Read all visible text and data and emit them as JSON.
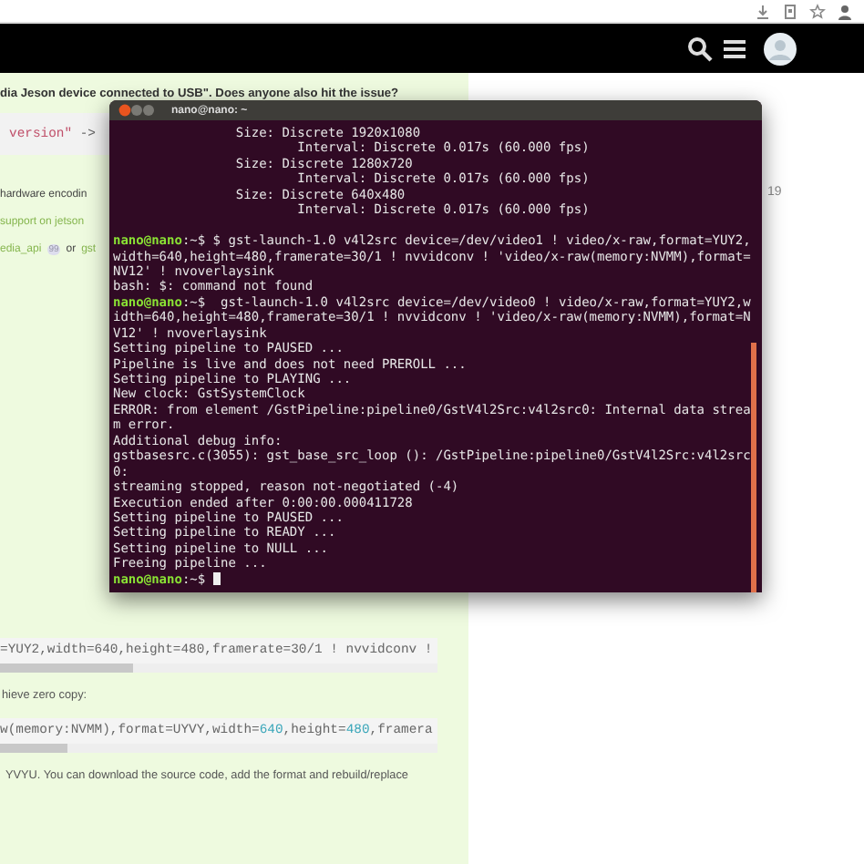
{
  "post": {
    "title": "dia Jeson device connected to USB\". Does anyone also hit the issue?",
    "code_top": [
      {
        "text": "version\"",
        "kind": "string"
      },
      {
        "text": " ->",
        "kind": "plain"
      }
    ],
    "lines": [
      [
        {
          "text": "hardware encodin",
          "kind": "text"
        }
      ],
      [
        {
          "text": "support on jetson",
          "kind": "link"
        }
      ],
      [
        {
          "text": "edia_api",
          "kind": "link"
        },
        {
          "text": "99",
          "kind": "badge"
        },
        {
          "text": "or",
          "kind": "text"
        },
        {
          "text": "gst",
          "kind": "link"
        }
      ]
    ],
    "code_block_1": [
      {
        "text": "=YUY2,width=640,height=480,framerate=30/1 ! nvvidconv !",
        "kind": "plain"
      }
    ],
    "text_2": "hieve zero copy:",
    "code_block_2": [
      {
        "text": "w(memory:NVMM),format=UYVY,width=",
        "kind": "plain"
      },
      {
        "text": "640",
        "kind": "number"
      },
      {
        "text": ",height=",
        "kind": "plain"
      },
      {
        "text": "480",
        "kind": "number"
      },
      {
        "text": ",framera",
        "kind": "plain"
      }
    ],
    "text_3": "YVYU. You can download the source code, add the format and rebuild/replace"
  },
  "side": {
    "date": "19"
  },
  "terminal": {
    "title": "nano@nano: ~",
    "lines": [
      {
        "kind": "output",
        "text": "                Size: Discrete 1920x1080"
      },
      {
        "kind": "output",
        "text": "                        Interval: Discrete 0.017s (60.000 fps)"
      },
      {
        "kind": "output",
        "text": "                Size: Discrete 1280x720"
      },
      {
        "kind": "output",
        "text": "                        Interval: Discrete 0.017s (60.000 fps)"
      },
      {
        "kind": "output",
        "text": "                Size: Discrete 640x480"
      },
      {
        "kind": "output",
        "text": "                        Interval: Discrete 0.017s (60.000 fps)"
      },
      {
        "kind": "blank"
      },
      {
        "kind": "prompt",
        "prompt": "nano@nano",
        "text": ":~$ $ gst-launch-1.0 v4l2src device=/dev/video1 ! video/x-raw,format=YUY2,"
      },
      {
        "kind": "output",
        "text": "width=640,height=480,framerate=30/1 ! nvvidconv ! 'video/x-raw(memory:NVMM),format="
      },
      {
        "kind": "output",
        "text": "NV12' ! nvoverlaysink"
      },
      {
        "kind": "output",
        "text": "bash: $: command not found"
      },
      {
        "kind": "prompt",
        "prompt": "nano@nano",
        "text": ":~$  gst-launch-1.0 v4l2src device=/dev/video0 ! video/x-raw,format=YUY2,w"
      },
      {
        "kind": "output",
        "text": "idth=640,height=480,framerate=30/1 ! nvvidconv ! 'video/x-raw(memory:NVMM),format=N"
      },
      {
        "kind": "output",
        "text": "V12' ! nvoverlaysink"
      },
      {
        "kind": "output",
        "text": "Setting pipeline to PAUSED ..."
      },
      {
        "kind": "output",
        "text": "Pipeline is live and does not need PREROLL ..."
      },
      {
        "kind": "output",
        "text": "Setting pipeline to PLAYING ..."
      },
      {
        "kind": "output",
        "text": "New clock: GstSystemClock"
      },
      {
        "kind": "output",
        "text": "ERROR: from element /GstPipeline:pipeline0/GstV4l2Src:v4l2src0: Internal data strea"
      },
      {
        "kind": "output",
        "text": "m error."
      },
      {
        "kind": "output",
        "text": "Additional debug info:"
      },
      {
        "kind": "output",
        "text": "gstbasesrc.c(3055): gst_base_src_loop (): /GstPipeline:pipeline0/GstV4l2Src:v4l2src"
      },
      {
        "kind": "output",
        "text": "0:"
      },
      {
        "kind": "output",
        "text": "streaming stopped, reason not-negotiated (-4)"
      },
      {
        "kind": "output",
        "text": "Execution ended after 0:00:00.000411728"
      },
      {
        "kind": "output",
        "text": "Setting pipeline to PAUSED ..."
      },
      {
        "kind": "output",
        "text": "Setting pipeline to READY ..."
      },
      {
        "kind": "output",
        "text": "Setting pipeline to NULL ..."
      },
      {
        "kind": "output",
        "text": "Freeing pipeline ..."
      },
      {
        "kind": "prompt",
        "prompt": "nano@nano",
        "text": ":~$ ",
        "cursor": true
      }
    ]
  }
}
